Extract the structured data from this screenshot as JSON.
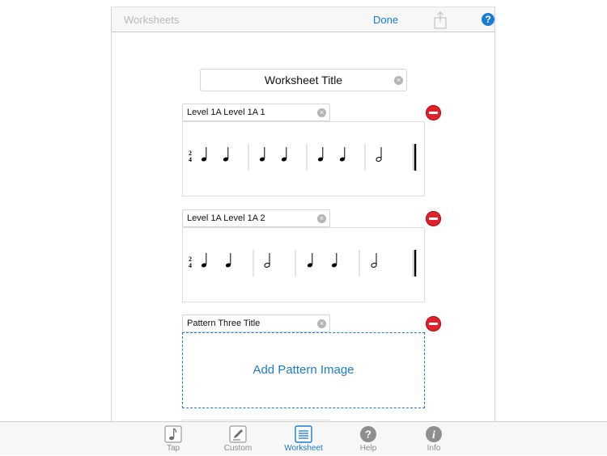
{
  "navbar": {
    "back_label": "Worksheets",
    "done_label": "Done",
    "help_glyph": "?",
    "share_icon": "share-icon",
    "help_icon": "question-circle-icon"
  },
  "worksheet": {
    "title_value": "Worksheet Title",
    "patterns": [
      {
        "title": "Level 1A Level 1A 1",
        "time_signature": [
          "2",
          "4"
        ]
      },
      {
        "title": "Level 1A Level 1A 2",
        "time_signature": [
          "2",
          "4"
        ]
      },
      {
        "title": "Pattern Three Title"
      }
    ],
    "add_image_label": "Add Pattern Image"
  },
  "tabs": [
    {
      "label": "Tap",
      "icon": "music-note-icon",
      "active": false
    },
    {
      "label": "Custom",
      "icon": "pencil-icon",
      "active": false
    },
    {
      "label": "Worksheet",
      "icon": "list-icon",
      "active": true
    },
    {
      "label": "Help",
      "icon": "question-circle-icon",
      "active": false
    },
    {
      "label": "Info",
      "icon": "info-circle-icon",
      "active": false
    }
  ],
  "colors": {
    "accent": "#1a7bd6",
    "remove": "#e0202a",
    "inactive": "#8e8e8e"
  }
}
